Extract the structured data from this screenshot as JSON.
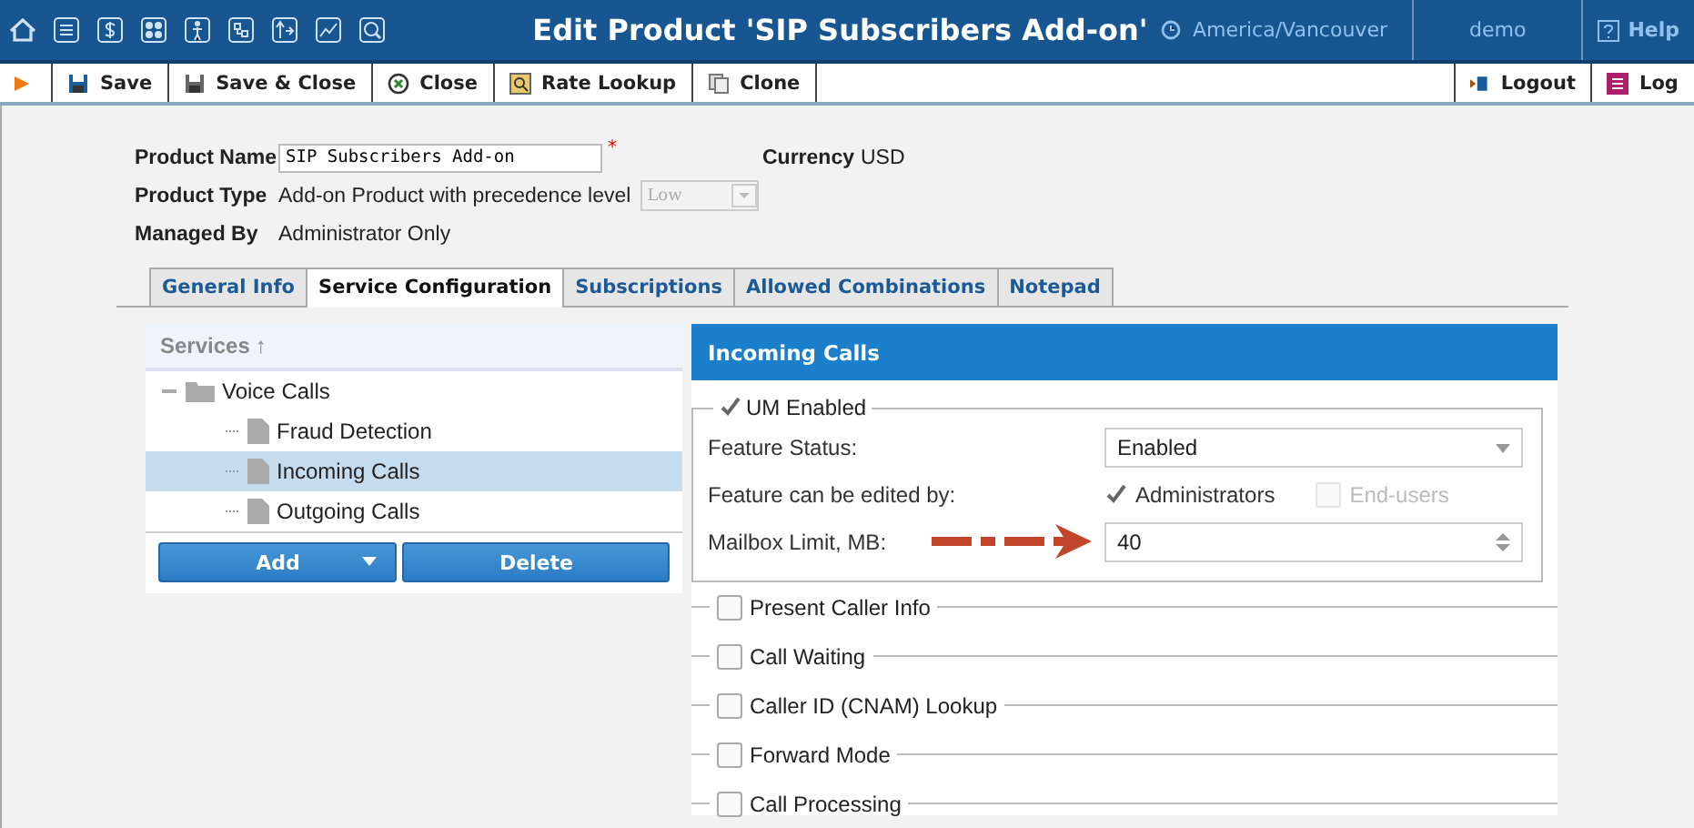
{
  "window": {
    "title": "Edit Product 'SIP Subscribers Add-on'",
    "timezone": "America/Vancouver",
    "user": "demo",
    "help": "Help"
  },
  "toolbar": {
    "buttons": [
      "Save",
      "Save & Close",
      "Close",
      "Rate Lookup",
      "Clone"
    ],
    "right_buttons": [
      "Logout",
      "Log"
    ]
  },
  "form": {
    "product_name_label": "Product Name",
    "product_name": "SIP Subscribers Add-on",
    "required_mark": "*",
    "currency_label": "Currency",
    "currency": "USD",
    "product_type_label": "Product Type",
    "product_type": "Add-on Product with precedence level",
    "precedence": "Low",
    "managed_by_label": "Managed By",
    "managed_by": "Administrator Only"
  },
  "tabs": [
    {
      "label": "General Info",
      "selected": false
    },
    {
      "label": "Service Configuration",
      "selected": true
    },
    {
      "label": "Subscriptions",
      "selected": false
    },
    {
      "label": "Allowed Combinations",
      "selected": false
    },
    {
      "label": "Notepad",
      "selected": false
    }
  ],
  "services": {
    "heading": "Services",
    "sort_mark": "↑",
    "tree": [
      {
        "label": "Voice Calls",
        "selected": false,
        "expanded": true,
        "children": [
          {
            "label": "Fraud Detection",
            "selected": false
          },
          {
            "label": "Incoming Calls",
            "selected": true
          },
          {
            "label": "Outgoing Calls",
            "selected": false
          }
        ]
      }
    ],
    "buttons": [
      "Add",
      "Delete"
    ]
  },
  "details": {
    "title": "Incoming Calls",
    "um": {
      "label": "UM Enabled",
      "checked": true,
      "feature_status_label": "Feature Status:",
      "feature_status": "Enabled",
      "edited_by_label": "Feature can be edited by:",
      "editors": [
        {
          "label": "Administrators",
          "checked": true,
          "disabled": false
        },
        {
          "label": "End-users",
          "checked": false,
          "disabled": true
        }
      ],
      "mailbox_label": "Mailbox Limit, MB:",
      "mailbox": "40"
    },
    "sections": [
      {
        "label": "Present Caller Info",
        "checked": false
      },
      {
        "label": "Call Waiting",
        "checked": false
      },
      {
        "label": "Caller ID (CNAM) Lookup",
        "checked": false
      },
      {
        "label": "Forward Mode",
        "checked": false
      },
      {
        "label": "Call Processing",
        "checked": false
      }
    ]
  }
}
